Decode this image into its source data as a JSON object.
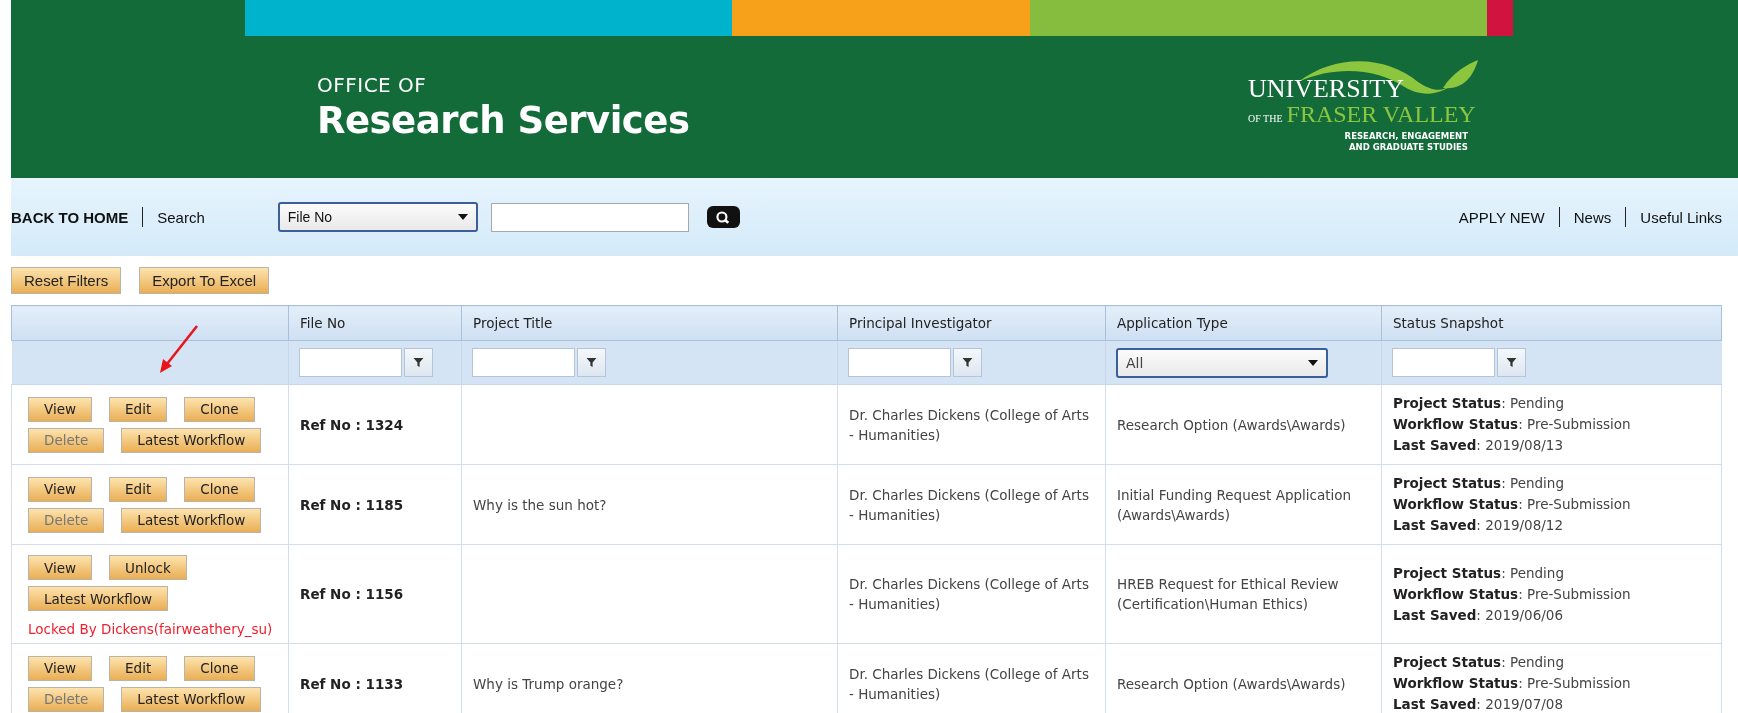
{
  "header": {
    "overline": "OFFICE OF",
    "title": "Research Services",
    "logo": {
      "line_1": "UNIVERSITY",
      "prefix": "OF THE",
      "line_2": "FRASER VALLEY",
      "subtitle_1": "RESEARCH, ENGAGEMENT",
      "subtitle_2": "AND GRADUATE STUDIES"
    }
  },
  "nav": {
    "home": "BACK TO HOME",
    "search_label": "Search",
    "search_select": "File No",
    "right_links": [
      "APPLY NEW",
      "News",
      "Useful Links"
    ]
  },
  "toolbar": [
    "Reset Filters",
    "Export To Excel"
  ],
  "table": {
    "columns": [
      "File No",
      "Project Title",
      "Principal Investigator",
      "Application Type",
      "Status Snapshot"
    ],
    "filters": [
      {
        "kind": "text"
      },
      {
        "kind": "text"
      },
      {
        "kind": "text"
      },
      {
        "kind": "select",
        "value": "All"
      },
      {
        "kind": "text"
      }
    ],
    "rows": [
      {
        "actions": [
          [
            {
              "label": "View",
              "disabled": false
            },
            {
              "label": "Edit",
              "disabled": false
            },
            {
              "label": "Clone",
              "disabled": false
            }
          ],
          [
            {
              "label": "Delete",
              "disabled": true
            },
            {
              "label": "Latest Workflow",
              "disabled": false
            }
          ]
        ],
        "file_no": "Ref No : 1324",
        "title": "",
        "pi": "Dr. Charles Dickens (College of Arts - Humanities)",
        "type": "Research Option (Awards\\Awards)",
        "status": [
          "**Project Status**: Pending",
          "**Workflow Status**: Pre-Submission",
          "**Last Saved**: 2019/08/13"
        ]
      },
      {
        "actions": [
          [
            {
              "label": "View",
              "disabled": false
            },
            {
              "label": "Edit",
              "disabled": false
            },
            {
              "label": "Clone",
              "disabled": false
            }
          ],
          [
            {
              "label": "Delete",
              "disabled": true
            },
            {
              "label": "Latest Workflow",
              "disabled": false
            }
          ]
        ],
        "file_no": "Ref No : 1185",
        "title": "Why is the sun hot?",
        "pi": "Dr. Charles Dickens (College of Arts - Humanities)",
        "type": "Initial Funding Request Application (Awards\\Awards)",
        "status": [
          "**Project Status**: Pending",
          "**Workflow Status**: Pre-Submission",
          "**Last Saved**: 2019/08/12"
        ]
      },
      {
        "actions": [
          [
            {
              "label": "View",
              "disabled": false
            },
            {
              "label": "Unlock",
              "disabled": false
            }
          ],
          [
            {
              "label": "Latest Workflow",
              "disabled": false
            }
          ]
        ],
        "lock_note": "Locked By Dickens(fairweathery_su)",
        "file_no": "Ref No : 1156",
        "title": "",
        "pi": "Dr. Charles Dickens (College of Arts - Humanities)",
        "type": "HREB Request for Ethical Review (Certification\\Human Ethics)",
        "status": [
          "**Project Status**: Pending",
          "**Workflow Status**: Pre-Submission",
          "**Last Saved**: 2019/06/06"
        ]
      },
      {
        "actions": [
          [
            {
              "label": "View",
              "disabled": false
            },
            {
              "label": "Edit",
              "disabled": false
            },
            {
              "label": "Clone",
              "disabled": false
            }
          ],
          [
            {
              "label": "Delete",
              "disabled": true
            },
            {
              "label": "Latest Workflow",
              "disabled": false
            }
          ]
        ],
        "file_no": "Ref No : 1133",
        "title": "Why is Trump orange?",
        "pi": "Dr. Charles Dickens (College of Arts - Humanities)",
        "type": "Research Option (Awards\\Awards)",
        "status": [
          "**Project Status**: Pending",
          "**Workflow Status**: Pre-Submission",
          "**Last Saved**: 2019/07/08"
        ]
      }
    ]
  }
}
